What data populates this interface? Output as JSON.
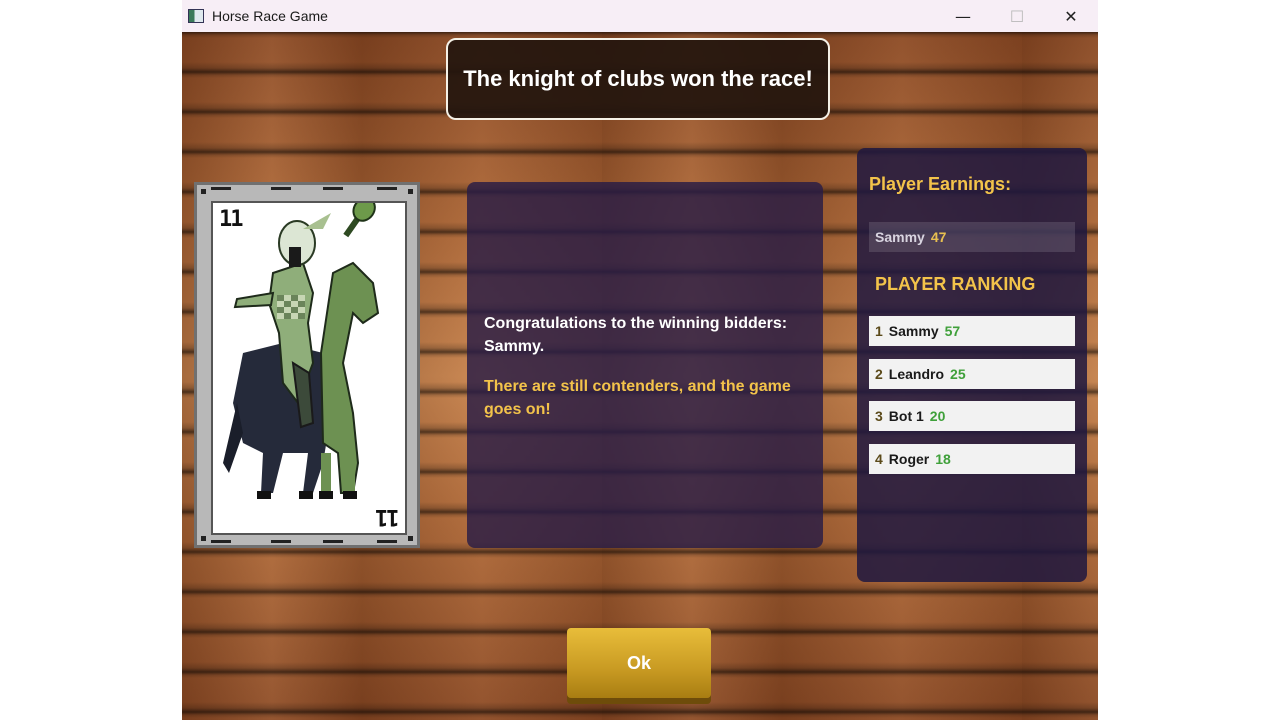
{
  "window": {
    "title": "Horse Race Game",
    "minimize_glyph": "—",
    "maximize_glyph": "☐",
    "close_glyph": "✕"
  },
  "banner": {
    "text": "The knight of clubs won the race!"
  },
  "card": {
    "value": "11",
    "suit": "clubs",
    "figure": "knight"
  },
  "message": {
    "winners_line": "Congratulations to the winning bidders: Sammy.",
    "status_line": "There are still contenders, and the game goes on!"
  },
  "earnings": {
    "title": "Player Earnings:",
    "rows": [
      {
        "name": "Sammy",
        "value": "47"
      }
    ]
  },
  "ranking": {
    "title": "PLAYER RANKING",
    "rows": [
      {
        "position": "1",
        "name": "Sammy",
        "score": "57"
      },
      {
        "position": "2",
        "name": "Leandro",
        "score": "25"
      },
      {
        "position": "3",
        "name": "Bot 1",
        "score": "20"
      },
      {
        "position": "4",
        "name": "Roger",
        "score": "18"
      }
    ]
  },
  "ok_button": {
    "label": "Ok"
  },
  "colors": {
    "accent_gold": "#f3c34a",
    "score_green": "#3fa03a",
    "panel_purple": "#281c46"
  }
}
